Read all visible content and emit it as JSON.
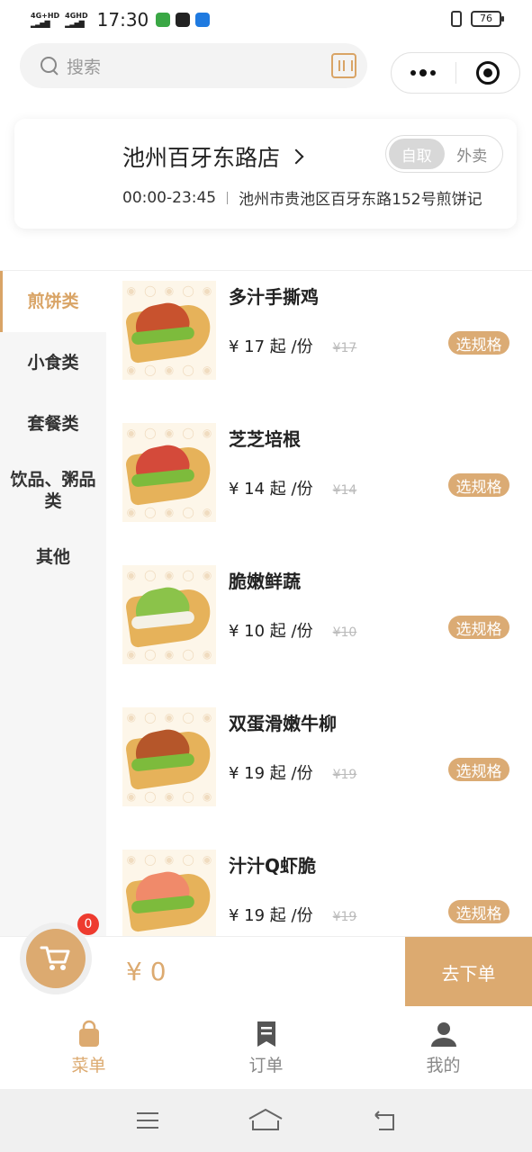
{
  "status_bar": {
    "network1": "4G+HD",
    "network2": "4GHD",
    "time": "17:30",
    "battery": "76"
  },
  "search": {
    "placeholder": "搜索"
  },
  "store": {
    "name": "池州百牙东路店",
    "hours": "00:00-23:45",
    "address": "池州市贵池区百牙东路152号煎饼记",
    "mode_pickup": "自取",
    "mode_delivery": "外卖",
    "active_mode": "pickup"
  },
  "categories": [
    {
      "label": "煎饼类",
      "active": true
    },
    {
      "label": "小食类",
      "active": false
    },
    {
      "label": "套餐类",
      "active": false
    },
    {
      "label": "饮品、粥品类",
      "active": false
    },
    {
      "label": "其他",
      "active": false
    }
  ],
  "products": [
    {
      "name": "多汁手撕鸡",
      "price": "¥ 17 起 /份",
      "original": "¥17",
      "button": "选规格"
    },
    {
      "name": "芝芝培根",
      "price": "¥ 14 起 /份",
      "original": "¥14",
      "button": "选规格"
    },
    {
      "name": "脆嫩鲜蔬",
      "price": "¥ 10 起 /份",
      "original": "¥10",
      "button": "选规格"
    },
    {
      "name": "双蛋滑嫩牛柳",
      "price": "¥ 19 起 /份",
      "original": "¥19",
      "button": "选规格"
    },
    {
      "name": "汁汁Q虾脆",
      "price": "¥ 19 起 /份",
      "original": "¥19",
      "button": "选规格"
    }
  ],
  "cart": {
    "count": "0",
    "total": "¥ 0",
    "checkout_label": "去下单"
  },
  "tabs": [
    {
      "label": "菜单",
      "icon": "bag-icon",
      "active": true
    },
    {
      "label": "订单",
      "icon": "orders-icon",
      "active": false
    },
    {
      "label": "我的",
      "icon": "user-icon",
      "active": false
    }
  ],
  "colors": {
    "accent": "#dcaa70",
    "badge": "#ee3b2f"
  }
}
